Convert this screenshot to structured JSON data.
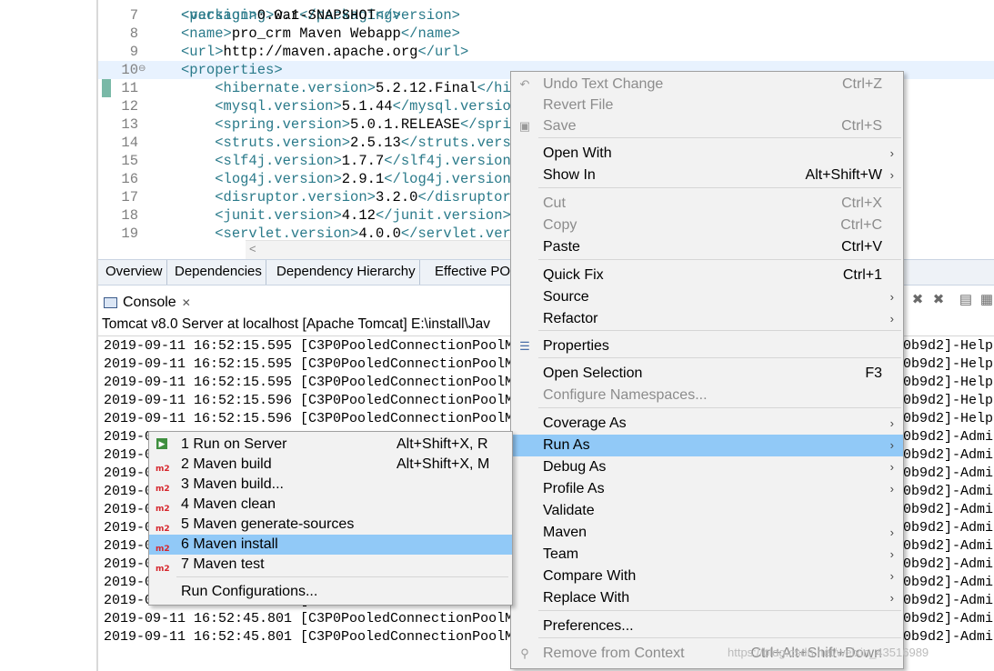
{
  "editor": {
    "lines": [
      {
        "num": "7",
        "code": "<version>0.0.1-SNAPSHOT</version>"
      },
      {
        "num": "8",
        "code": "<name>pro_crm Maven Webapp</name>"
      },
      {
        "num": "9",
        "code": "<url>http://maven.apache.org</url>"
      },
      {
        "num": "10",
        "code": "<properties>"
      },
      {
        "num": "11",
        "code": "    <hibernate.version>5.2.12.Final</hib"
      },
      {
        "num": "12",
        "code": "    <mysql.version>5.1.44</mysql.version"
      },
      {
        "num": "13",
        "code": "    <spring.version>5.0.1.RELEASE</sprin"
      },
      {
        "num": "14",
        "code": "    <struts.version>2.5.13</struts.versi"
      },
      {
        "num": "15",
        "code": "    <slf4j.version>1.7.7</slf4j.version>"
      },
      {
        "num": "16",
        "code": "    <log4j.version>2.9.1</log4j.version>"
      },
      {
        "num": "17",
        "code": "    <disruptor.version>3.2.0</disruptor."
      },
      {
        "num": "18",
        "code": "    <junit.version>4.12</junit.version>"
      },
      {
        "num": "19",
        "code": "    <servlet.version>4.0.0</servlet.vers"
      }
    ],
    "partial_top": "<packaging>war</packaging>",
    "fold_marker": "⊖"
  },
  "pom_tabs": [
    "Overview",
    "Dependencies",
    "Dependency Hierarchy",
    "Effective PO"
  ],
  "console": {
    "tab_label": "Console",
    "close": "✕",
    "title": "Tomcat v8.0 Server at localhost [Apache Tomcat] E:\\install\\Jav",
    "lines": [
      "2019-09-11 16:52:15.595 [C3P0PooledConnectionPoolM",
      "2019-09-11 16:52:15.595 [C3P0PooledConnectionPoolM",
      "2019-09-11 16:52:15.595 [C3P0PooledConnectionPoolM",
      "2019-09-11 16:52:15.596 [C3P0PooledConnectionPoolM",
      "2019-09-11 16:52:15.596 [C3P0PooledConnectionPoolM",
      "2019-0",
      "2019-0",
      "2019-0",
      "2019-0",
      "2019-0",
      "2019-0",
      "2019-0",
      "2019-0",
      "2019-0",
      "2019-09-11 16:52:45.801 [C3P0PooledConnectionPoolM",
      "2019-09-11 16:52:45.801 [C3P0PooledConnectionPoolM",
      "2019-09-11 16:52:45.801 [C3P0PooledConnectionPoolM"
    ],
    "right_lines": [
      "0b9d2]-Helpe",
      "0b9d2]-Helpe",
      "0b9d2]-Helpe",
      "0b9d2]-Helpe",
      "0b9d2]-Helpe",
      "0b9d2]-Admin",
      "0b9d2]-Admin",
      "0b9d2]-Admin",
      "0b9d2]-Admin",
      "0b9d2]-Admin",
      "0b9d2]-Admin",
      "0b9d2]-Admin",
      "0b9d2]-Admin",
      "0b9d2]-Admin",
      "0b9d2]-Admin",
      "0b9d2]-Admin",
      "0b9d2]-Admin"
    ]
  },
  "context_menu": {
    "items": [
      {
        "label": "Undo Text Change",
        "accel": "Ctrl+Z",
        "disabled": true,
        "icon": "undo-icon"
      },
      {
        "label": "Revert File",
        "accel": "",
        "disabled": true
      },
      {
        "label": "Save",
        "accel": "Ctrl+S",
        "disabled": true,
        "icon": "save-icon"
      },
      {
        "label": "Open With",
        "accel": "",
        "submenu": true
      },
      {
        "label": "Show In",
        "accel": "Alt+Shift+W",
        "submenu": true
      },
      {
        "label": "Cut",
        "accel": "Ctrl+X",
        "disabled": true
      },
      {
        "label": "Copy",
        "accel": "Ctrl+C",
        "disabled": true
      },
      {
        "label": "Paste",
        "accel": "Ctrl+V"
      },
      {
        "label": "Quick Fix",
        "accel": "Ctrl+1"
      },
      {
        "label": "Source",
        "accel": "",
        "submenu": true
      },
      {
        "label": "Refactor",
        "accel": "",
        "submenu": true
      },
      {
        "label": "Properties",
        "accel": "",
        "icon": "properties-icon"
      },
      {
        "label": "Open Selection",
        "accel": "F3"
      },
      {
        "label": "Configure Namespaces...",
        "accel": "",
        "disabled": true
      },
      {
        "label": "Coverage As",
        "accel": "",
        "submenu": true
      },
      {
        "label": "Run As",
        "accel": "",
        "submenu": true,
        "highlighted": true
      },
      {
        "label": "Debug As",
        "accel": "",
        "submenu": true
      },
      {
        "label": "Profile As",
        "accel": "",
        "submenu": true
      },
      {
        "label": "Validate",
        "accel": ""
      },
      {
        "label": "Maven",
        "accel": "",
        "submenu": true
      },
      {
        "label": "Team",
        "accel": "",
        "submenu": true
      },
      {
        "label": "Compare With",
        "accel": "",
        "submenu": true
      },
      {
        "label": "Replace With",
        "accel": "",
        "submenu": true
      },
      {
        "label": "Preferences...",
        "accel": ""
      },
      {
        "label": "Remove from Context",
        "accel": "Ctrl+Alt+Shift+Down",
        "disabled": true,
        "icon": "remove-context-icon"
      }
    ],
    "arrow": "›"
  },
  "run_as_submenu": {
    "items": [
      {
        "label": "1 Run on Server",
        "accel": "Alt+Shift+X, R",
        "icon": "run-on-server-icon"
      },
      {
        "label": "2 Maven build",
        "accel": "Alt+Shift+X, M",
        "icon": "m2-icon"
      },
      {
        "label": "3 Maven build...",
        "accel": "",
        "icon": "m2-icon"
      },
      {
        "label": "4 Maven clean",
        "accel": "",
        "icon": "m2-icon"
      },
      {
        "label": "5 Maven generate-sources",
        "accel": "",
        "icon": "m2-icon"
      },
      {
        "label": "6 Maven install",
        "accel": "",
        "icon": "m2-icon",
        "highlighted": true
      },
      {
        "label": "7 Maven test",
        "accel": "",
        "icon": "m2-icon"
      },
      {
        "label": "Run Configurations...",
        "accel": ""
      }
    ],
    "m2_text": "m2"
  },
  "watermark": "https://blog.csdn.net/weixin_43516989",
  "colors": {
    "highlight": "#91c9f7",
    "menu_bg": "#f2f2f2",
    "xml_tag": "#2a7a8a"
  }
}
